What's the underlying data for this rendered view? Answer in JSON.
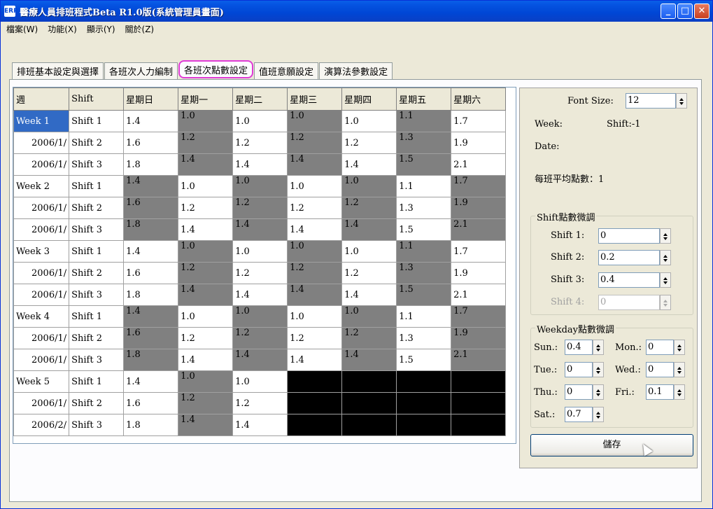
{
  "window": {
    "icon": "ERP",
    "title": "醫療人員排班程式Beta R1.0版(系統管理員畫面)",
    "min": "_",
    "max": "□",
    "close": "✕"
  },
  "menu": [
    "檔案(W)",
    "功能(X)",
    "顯示(Y)",
    "關於(Z)"
  ],
  "tabs": [
    "排班基本設定與選擇",
    "各班次人力編制",
    "各班次點數設定",
    "值班意願設定",
    "演算法參數設定"
  ],
  "active_tab": 2,
  "grid": {
    "headers": [
      "週",
      "Shift",
      "星期日",
      "星期一",
      "星期二",
      "星期三",
      "星期四",
      "星期五",
      "星期六"
    ],
    "rows": [
      {
        "c0": "Week 1",
        "c1": "Shift 1",
        "v": [
          "1.4",
          "1.0",
          "1.0",
          "1.0",
          "1.0",
          "1.1",
          "1.7"
        ],
        "k": "wgwgwgw",
        "sel": true
      },
      {
        "c0": "2006/1/",
        "c1": "Shift 2",
        "v": [
          "1.6",
          "1.2",
          "1.2",
          "1.2",
          "1.2",
          "1.3",
          "1.9"
        ],
        "k": "wgwgwgw"
      },
      {
        "c0": "2006/1/",
        "c1": "Shift 3",
        "v": [
          "1.8",
          "1.4",
          "1.4",
          "1.4",
          "1.4",
          "1.5",
          "2.1"
        ],
        "k": "wgwgwgw"
      },
      {
        "c0": "Week 2",
        "c1": "Shift 1",
        "v": [
          "1.4",
          "1.0",
          "1.0",
          "1.0",
          "1.0",
          "1.1",
          "1.7"
        ],
        "k": "gwgwgwg"
      },
      {
        "c0": "2006/1/",
        "c1": "Shift 2",
        "v": [
          "1.6",
          "1.2",
          "1.2",
          "1.2",
          "1.2",
          "1.3",
          "1.9"
        ],
        "k": "gwgwgwg"
      },
      {
        "c0": "2006/1/",
        "c1": "Shift 3",
        "v": [
          "1.8",
          "1.4",
          "1.4",
          "1.4",
          "1.4",
          "1.5",
          "2.1"
        ],
        "k": "gwgwgwg"
      },
      {
        "c0": "Week 3",
        "c1": "Shift 1",
        "v": [
          "1.4",
          "1.0",
          "1.0",
          "1.0",
          "1.0",
          "1.1",
          "1.7"
        ],
        "k": "wgwgwgw"
      },
      {
        "c0": "2006/1/",
        "c1": "Shift 2",
        "v": [
          "1.6",
          "1.2",
          "1.2",
          "1.2",
          "1.2",
          "1.3",
          "1.9"
        ],
        "k": "wgwgwgw"
      },
      {
        "c0": "2006/1/",
        "c1": "Shift 3",
        "v": [
          "1.8",
          "1.4",
          "1.4",
          "1.4",
          "1.4",
          "1.5",
          "2.1"
        ],
        "k": "wgwgwgw"
      },
      {
        "c0": "Week 4",
        "c1": "Shift 1",
        "v": [
          "1.4",
          "1.0",
          "1.0",
          "1.0",
          "1.0",
          "1.1",
          "1.7"
        ],
        "k": "gwgwgwg"
      },
      {
        "c0": "2006/1/",
        "c1": "Shift 2",
        "v": [
          "1.6",
          "1.2",
          "1.2",
          "1.2",
          "1.2",
          "1.3",
          "1.9"
        ],
        "k": "gwgwgwg"
      },
      {
        "c0": "2006/1/",
        "c1": "Shift 3",
        "v": [
          "1.8",
          "1.4",
          "1.4",
          "1.4",
          "1.4",
          "1.5",
          "2.1"
        ],
        "k": "gwgwgwg"
      },
      {
        "c0": "Week 5",
        "c1": "Shift 1",
        "v": [
          "1.4",
          "1.0",
          "1.0",
          "",
          "",
          "",
          ""
        ],
        "k": "wgwbbbb"
      },
      {
        "c0": "2006/1/",
        "c1": "Shift 2",
        "v": [
          "1.6",
          "1.2",
          "1.2",
          "",
          "",
          "",
          ""
        ],
        "k": "wgwbbbb"
      },
      {
        "c0": "2006/2/",
        "c1": "Shift 3",
        "v": [
          "1.8",
          "1.4",
          "1.4",
          "",
          "",
          "",
          ""
        ],
        "k": "wgwbbbb"
      }
    ]
  },
  "panel": {
    "font_size_label": "Font Size:",
    "font_size": "12",
    "week_label": "Week:",
    "shift_label": "Shift:-1",
    "date_label": "Date:",
    "avg_label": "每班平均點數：1",
    "shift_group": "Shift點數微調",
    "shifts": [
      {
        "label": "Shift 1:",
        "value": "0"
      },
      {
        "label": "Shift 2:",
        "value": "0.2"
      },
      {
        "label": "Shift 3:",
        "value": "0.4"
      },
      {
        "label": "Shift 4:",
        "value": "0",
        "disabled": true
      }
    ],
    "weekday_group": "Weekday點數微調",
    "weekdays": [
      {
        "label": "Sun.:",
        "value": "0.4"
      },
      {
        "label": "Mon.:",
        "value": "0"
      },
      {
        "label": "Tue.:",
        "value": "0"
      },
      {
        "label": "Wed.:",
        "value": "0"
      },
      {
        "label": "Thu.:",
        "value": "0"
      },
      {
        "label": "Fri.:",
        "value": "0.1"
      },
      {
        "label": "Sat.:",
        "value": "0.7"
      }
    ],
    "save": "儲存"
  },
  "colors": {
    "gray_cell": "#808080",
    "black_cell": "#000000",
    "selected_cell": "#316ac5",
    "tab_highlight": "#e03bd6"
  }
}
